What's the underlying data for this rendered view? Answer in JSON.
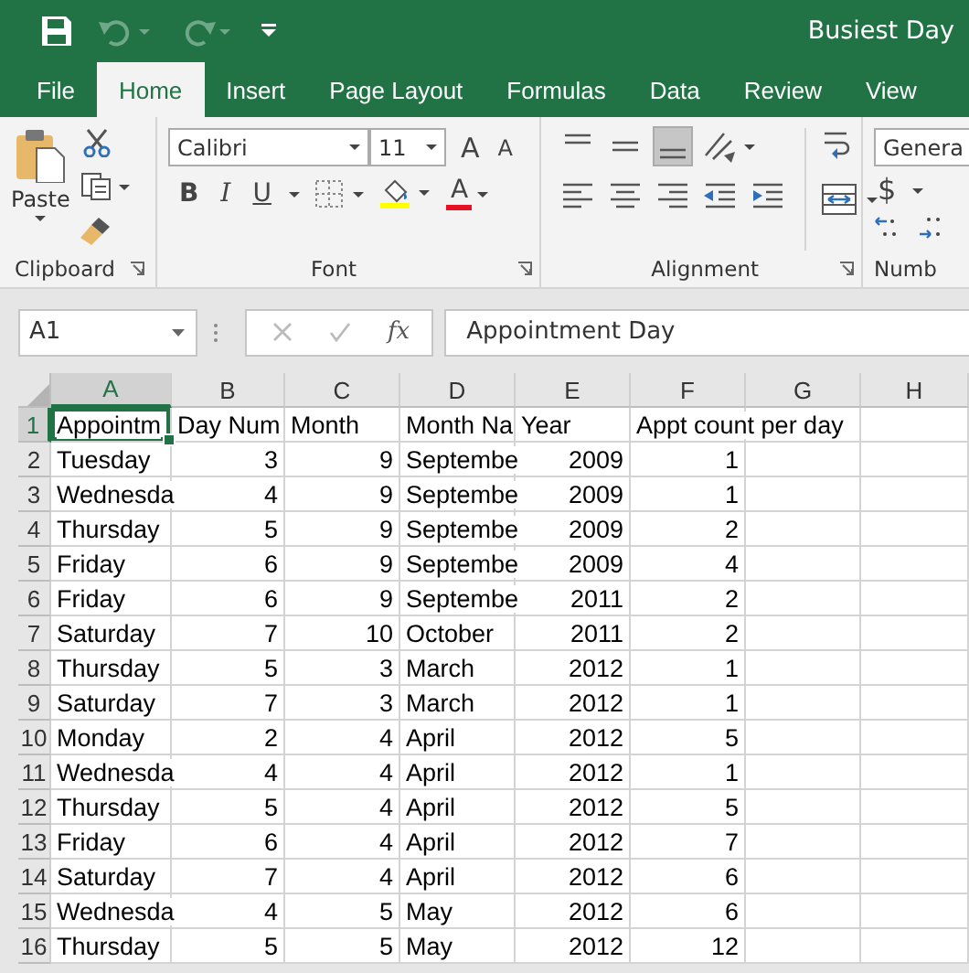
{
  "title_bar": {
    "title": "Busiest Day",
    "quick_access": [
      {
        "kind": "save",
        "disabled": false
      },
      {
        "kind": "undo",
        "disabled": true
      },
      {
        "kind": "redo",
        "disabled": true
      },
      {
        "kind": "customize",
        "disabled": false
      }
    ]
  },
  "ribbon_tabs": [
    {
      "label": "File",
      "selected": false
    },
    {
      "label": "Home",
      "selected": true
    },
    {
      "label": "Insert",
      "selected": false
    },
    {
      "label": "Page Layout",
      "selected": false
    },
    {
      "label": "Formulas",
      "selected": false
    },
    {
      "label": "Data",
      "selected": false
    },
    {
      "label": "Review",
      "selected": false
    },
    {
      "label": "View",
      "selected": false
    }
  ],
  "ribbon": {
    "clipboard": {
      "paste_label": "Paste",
      "group_label": "Clipboard"
    },
    "font": {
      "font_name": "Calibri",
      "font_size": "11",
      "grow_label": "A",
      "shrink_label": "A",
      "bold_label": "B",
      "italic_label": "I",
      "underline_label": "U",
      "font_color_label": "A",
      "group_label": "Font"
    },
    "alignment": {
      "buttons": [
        {
          "kind": "align-top",
          "pressed": false
        },
        {
          "kind": "align-middle",
          "pressed": false
        },
        {
          "kind": "align-bottom",
          "pressed": true
        }
      ],
      "group_label": "Alignment"
    },
    "number": {
      "format": "Genera",
      "currency_label": "$",
      "group_label": "Numb"
    }
  },
  "formula_bar": {
    "name_box": "A1",
    "function_label": "fx",
    "formula": "Appointment Day"
  },
  "sheet": {
    "columns": [
      {
        "label": "A",
        "kind": "text",
        "selected": true
      },
      {
        "label": "B",
        "kind": "number",
        "selected": false
      },
      {
        "label": "C",
        "kind": "number",
        "selected": false
      },
      {
        "label": "D",
        "kind": "text",
        "selected": false
      },
      {
        "label": "E",
        "kind": "number",
        "selected": false
      },
      {
        "label": "F",
        "kind": "number",
        "selected": false
      },
      {
        "label": "G",
        "kind": "text",
        "selected": false
      },
      {
        "label": "H",
        "kind": "text",
        "selected": false
      }
    ],
    "rows": [
      {
        "number": "1",
        "kind": "label",
        "selected": true,
        "cells": [
          "Appointm",
          "Day Num",
          "Month",
          "Month Na",
          "Year",
          "Appt count per day"
        ]
      },
      {
        "number": "2",
        "kind": "data",
        "selected": false,
        "cells": [
          "Tuesday",
          "3",
          "9",
          "Septembe",
          "2009",
          "1"
        ]
      },
      {
        "number": "3",
        "kind": "data",
        "selected": false,
        "cells": [
          "Wednesda",
          "4",
          "9",
          "Septembe",
          "2009",
          "1"
        ]
      },
      {
        "number": "4",
        "kind": "data",
        "selected": false,
        "cells": [
          "Thursday",
          "5",
          "9",
          "Septembe",
          "2009",
          "2"
        ]
      },
      {
        "number": "5",
        "kind": "data",
        "selected": false,
        "cells": [
          "Friday",
          "6",
          "9",
          "Septembe",
          "2009",
          "4"
        ]
      },
      {
        "number": "6",
        "kind": "data",
        "selected": false,
        "cells": [
          "Friday",
          "6",
          "9",
          "Septembe",
          "2011",
          "2"
        ]
      },
      {
        "number": "7",
        "kind": "data",
        "selected": false,
        "cells": [
          "Saturday",
          "7",
          "10",
          "October",
          "2011",
          "2"
        ]
      },
      {
        "number": "8",
        "kind": "data",
        "selected": false,
        "cells": [
          "Thursday",
          "5",
          "3",
          "March",
          "2012",
          "1"
        ]
      },
      {
        "number": "9",
        "kind": "data",
        "selected": false,
        "cells": [
          "Saturday",
          "7",
          "3",
          "March",
          "2012",
          "1"
        ]
      },
      {
        "number": "10",
        "kind": "data",
        "selected": false,
        "cells": [
          "Monday",
          "2",
          "4",
          "April",
          "2012",
          "5"
        ]
      },
      {
        "number": "11",
        "kind": "data",
        "selected": false,
        "cells": [
          "Wednesda",
          "4",
          "4",
          "April",
          "2012",
          "1"
        ]
      },
      {
        "number": "12",
        "kind": "data",
        "selected": false,
        "cells": [
          "Thursday",
          "5",
          "4",
          "April",
          "2012",
          "5"
        ]
      },
      {
        "number": "13",
        "kind": "data",
        "selected": false,
        "cells": [
          "Friday",
          "6",
          "4",
          "April",
          "2012",
          "7"
        ]
      },
      {
        "number": "14",
        "kind": "data",
        "selected": false,
        "cells": [
          "Saturday",
          "7",
          "4",
          "April",
          "2012",
          "6"
        ]
      },
      {
        "number": "15",
        "kind": "data",
        "selected": false,
        "cells": [
          "Wednesda",
          "4",
          "5",
          "May",
          "2012",
          "6"
        ]
      },
      {
        "number": "16",
        "kind": "data",
        "selected": false,
        "cells": [
          "Thursday",
          "5",
          "5",
          "May",
          "2012",
          "12"
        ]
      }
    ]
  }
}
